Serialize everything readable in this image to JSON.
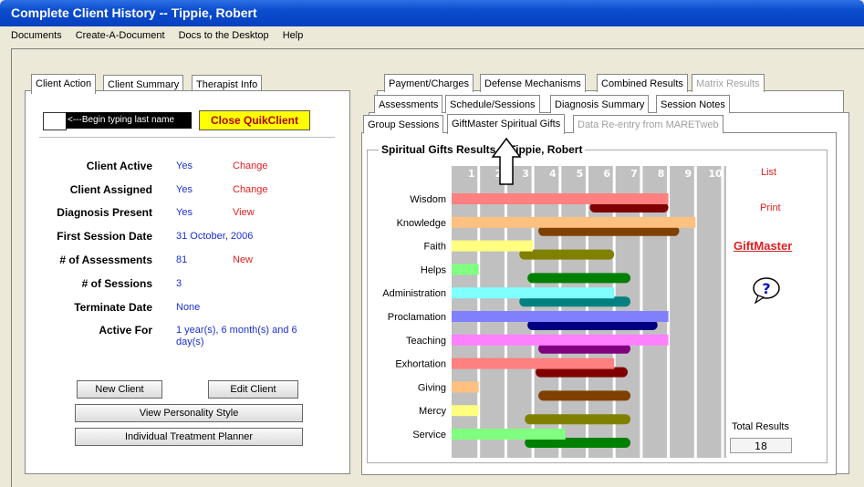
{
  "window": {
    "title": "Complete Client History  -- Tippie, Robert"
  },
  "menu": [
    {
      "label": "Documents"
    },
    {
      "label": "Create-A-Document"
    },
    {
      "label": "Docs to the Desktop"
    },
    {
      "label": "Help"
    }
  ],
  "left_tabs": [
    "Client Action",
    "Client Summary",
    "Therapist Info"
  ],
  "quik": {
    "hint": "<---Begin typing last name",
    "close_label": "Close QuikClient"
  },
  "info_rows": [
    {
      "label": "Client Active",
      "value": "Yes",
      "action": "Change"
    },
    {
      "label": "Client Assigned",
      "value": "Yes",
      "action": "Change"
    },
    {
      "label": "Diagnosis Present",
      "value": "Yes",
      "action": "View"
    },
    {
      "label": "First Session Date",
      "value": "31 October, 2006",
      "action": ""
    },
    {
      "label": "# of Assessments",
      "value": "81",
      "action": "New"
    },
    {
      "label": "# of Sessions",
      "value": "3",
      "action": ""
    },
    {
      "label": "Terminate Date",
      "value": "None",
      "action": ""
    },
    {
      "label": "Active For",
      "value": "1 year(s),  6 month(s) and  6 day(s)",
      "action": ""
    }
  ],
  "buttons": {
    "new_client": "New Client",
    "edit_client": "Edit Client",
    "personality": "View Personality Style",
    "planner": "Individual Treatment Planner"
  },
  "right_tabs": {
    "row1": [
      "Payment/Charges",
      "Defense Mechanisms",
      "Combined Results",
      "Matrix Results"
    ],
    "row2": [
      "Assessments",
      "Schedule/Sessions",
      "Diagnosis Summary",
      "Session Notes"
    ],
    "row3": [
      "Group Sessions",
      "GiftMaster Spiritual Gifts",
      "Data Re-entry from MARETweb"
    ]
  },
  "gifts_panel": {
    "title": "Spiritual Gifts Results -- Tippie, Robert",
    "list_link": "List",
    "print_link": "Print",
    "giftmaster_link": "GiftMaster",
    "help_icon": "question-balloon-icon",
    "total_label": "Total Results",
    "total_value": "18"
  },
  "chart_data": {
    "type": "bar",
    "xlim": [
      0,
      10
    ],
    "x_ticks": [
      "1",
      "2",
      "3",
      "4",
      "5",
      "6",
      "7",
      "8",
      "9",
      "10"
    ],
    "categories": [
      "Wisdom",
      "Knowledge",
      "Faith",
      "Helps",
      "Administration",
      "Proclamation",
      "Teaching",
      "Exhortation",
      "Giving",
      "Mercy",
      "Service"
    ],
    "series": [
      {
        "values": [
          8,
          9,
          3,
          1,
          6,
          8,
          8,
          6,
          1,
          1,
          4.2
        ],
        "color": "client-colored"
      },
      {
        "range": [
          [
            5.1,
            8
          ],
          [
            3.2,
            8.4
          ],
          [
            2.5,
            6
          ],
          [
            2.8,
            6.6
          ],
          [
            2.5,
            6.6
          ],
          [
            2.8,
            7.6
          ],
          [
            3.2,
            6.6
          ],
          [
            3.1,
            6.5
          ],
          [
            3.2,
            6.6
          ],
          [
            2.7,
            6.6
          ],
          [
            2.7,
            6.6
          ]
        ],
        "color": "norm-dark"
      }
    ],
    "colors": {
      "client": [
        "#ff8080",
        "#ffc080",
        "#ffff80",
        "#80ff80",
        "#80ffff",
        "#8080ff",
        "#ff80ff",
        "#ff8080",
        "#ffc080",
        "#ffff80",
        "#80ff80"
      ],
      "norm": [
        "#800000",
        "#804000",
        "#808000",
        "#008000",
        "#008080",
        "#000080",
        "#800080",
        "#800000",
        "#804000",
        "#808000",
        "#008000"
      ]
    },
    "grid": true
  }
}
